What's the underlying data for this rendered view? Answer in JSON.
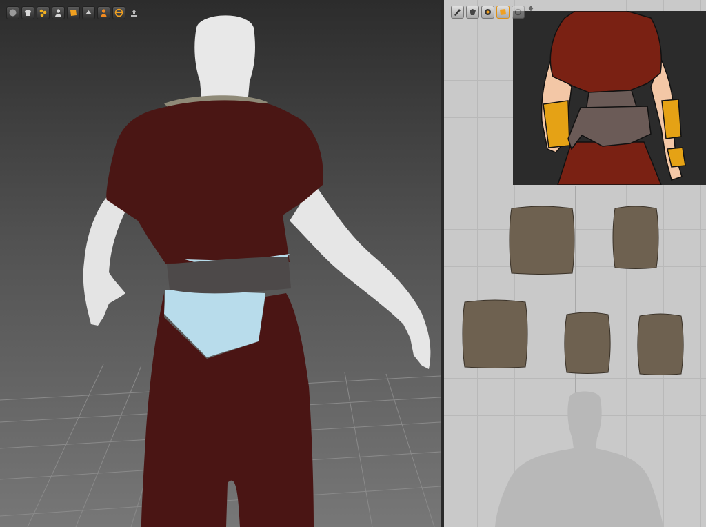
{
  "viewport3d": {
    "toolbar": [
      {
        "icon": "wireframe-sphere-icon",
        "color": "#9a9a9a"
      },
      {
        "icon": "avatar-icon",
        "color": "#d8d8d8"
      },
      {
        "icon": "particle-icon",
        "color": "#f0b020"
      },
      {
        "icon": "pin-user-icon",
        "color": "#d8d8d8"
      },
      {
        "icon": "fabric-icon",
        "color": "#f0a020"
      },
      {
        "icon": "layer-icon",
        "color": "#cfcfcf"
      },
      {
        "icon": "person-icon",
        "color": "#f08a20"
      },
      {
        "icon": "globe-icon",
        "color": "#f0a020"
      },
      {
        "icon": "export-icon",
        "color": "#bbbbbb"
      }
    ],
    "garment_colors": {
      "shirt": "#4a1614",
      "pants": "#4a1514",
      "belt": "#4d4949",
      "apron": "#b8dceb",
      "skin": "#e6e6e6",
      "collar": "#8f8a78"
    }
  },
  "view2d": {
    "toolbar": [
      {
        "icon": "pen-icon"
      },
      {
        "icon": "avatar-edit-icon"
      },
      {
        "icon": "texture-icon"
      },
      {
        "icon": "fabric-active-icon"
      },
      {
        "icon": "circle-icon"
      },
      {
        "icon": "move-icon"
      }
    ],
    "pattern_color": "#6e6150",
    "pattern_pieces": 5,
    "silhouette_color": "#b8b8b8"
  }
}
